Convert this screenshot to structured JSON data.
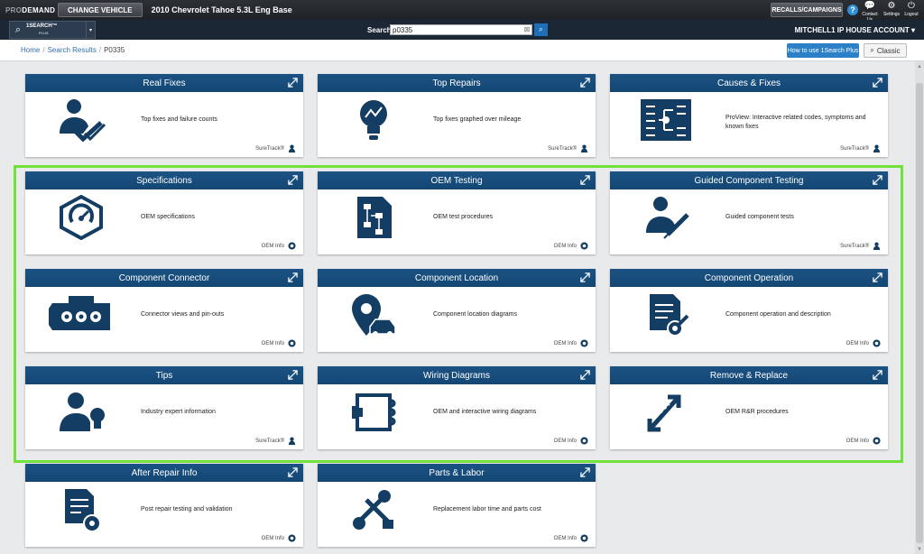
{
  "topbar": {
    "brand_pro": "PRO",
    "brand_rest": "DEMAND",
    "change_vehicle": "CHANGE VEHICLE",
    "vehicle": "2010 Chevrolet Tahoe 5.3L Eng Base",
    "recalls": "RECALLS/CAMPAIGNS",
    "help": "?",
    "contact": "Contact Us",
    "settings": "Settings",
    "logout": "Logout"
  },
  "searchbar": {
    "onesearch_label": "1SEARCH™",
    "onesearch_plus": "PLUS",
    "search_label": "Search",
    "search_value": "p0335",
    "account": "MITCHELL1 IP HOUSE ACCOUNT ▾"
  },
  "breadcrumb": {
    "home": "Home",
    "results": "Search Results",
    "current": "P0335",
    "sep": "/"
  },
  "buttons": {
    "how_to": "How to use 1Search Plus",
    "classic": "Classic"
  },
  "colors": {
    "header": "#174b7a",
    "icon": "#133d63",
    "accent": "#2b80c7",
    "highlight": "#6fe33a"
  },
  "cards": [
    {
      "title": "Real Fixes",
      "desc": "Top fixes and failure counts",
      "source": "SureTrack®",
      "icon": "person-check-icon"
    },
    {
      "title": "Top Repairs",
      "desc": "Top fixes graphed over mileage",
      "source": "SureTrack®",
      "icon": "lightbulb-graph-icon"
    },
    {
      "title": "Causes & Fixes",
      "desc": "ProView: Interactive related codes, symptoms and known fixes",
      "source": "SureTrack®",
      "icon": "tree-diagram-icon"
    },
    {
      "title": "Specifications",
      "desc": "OEM specifications",
      "source": "OEM Info",
      "icon": "gauge-nut-icon"
    },
    {
      "title": "OEM Testing",
      "desc": "OEM test procedures",
      "source": "OEM Info",
      "icon": "flowchart-document-icon"
    },
    {
      "title": "Guided Component Testing",
      "desc": "Guided component tests",
      "source": "SureTrack®",
      "icon": "person-probe-icon"
    },
    {
      "title": "Component Connector",
      "desc": "Connector views and pin-outs",
      "source": "OEM Info",
      "icon": "connector-icon"
    },
    {
      "title": "Component Location",
      "desc": "Component location diagrams",
      "source": "OEM Info",
      "icon": "location-pin-car-icon"
    },
    {
      "title": "Component Operation",
      "desc": "Component operation and description",
      "source": "OEM Info",
      "icon": "document-gear-icon"
    },
    {
      "title": "Tips",
      "desc": "Industry expert information",
      "source": "SureTrack®",
      "icon": "person-lightbulb-icon"
    },
    {
      "title": "Wiring Diagrams",
      "desc": "OEM and interactive wiring diagrams",
      "source": "OEM Info",
      "icon": "wiring-icon"
    },
    {
      "title": "Remove & Replace",
      "desc": "OEM R&R procedures",
      "source": "OEM Info",
      "icon": "remove-replace-arrows-icon"
    },
    {
      "title": "After Repair Info",
      "desc": "Post repair testing and validation",
      "source": "OEM Info",
      "icon": "document-steering-icon"
    },
    {
      "title": "Parts & Labor",
      "desc": "Replacement labor time and parts cost",
      "source": "OEM Info",
      "icon": "tools-icon"
    }
  ]
}
